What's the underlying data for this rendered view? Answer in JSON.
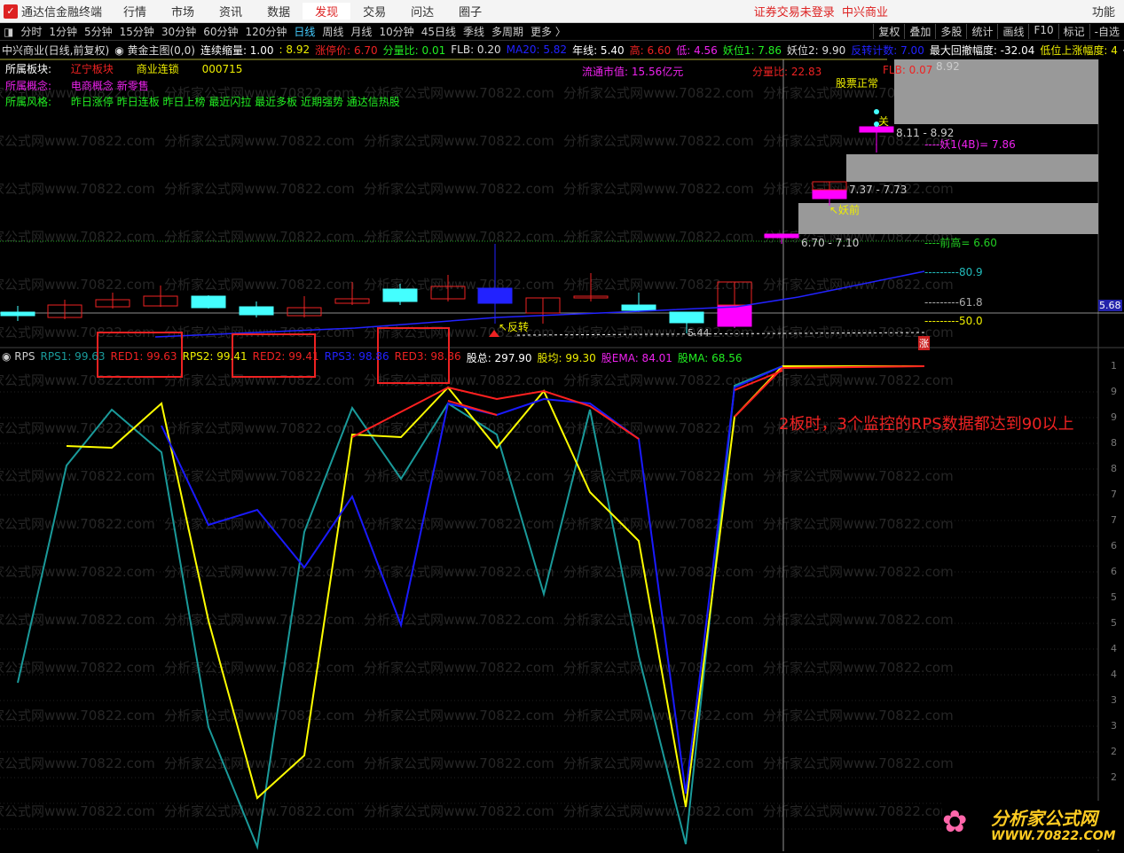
{
  "menu": {
    "app_title": "通达信金融终端",
    "items": [
      "行情",
      "市场",
      "资讯",
      "数据",
      "发现",
      "交易",
      "问达",
      "圈子"
    ],
    "active": "发现",
    "status": "证券交易未登录",
    "stock": "中兴商业",
    "function": "功能"
  },
  "periods": {
    "items": [
      "分时",
      "1分钟",
      "5分钟",
      "15分钟",
      "30分钟",
      "60分钟",
      "120分钟",
      "日线",
      "周线",
      "月线",
      "10分钟",
      "45日线",
      "季线",
      "多周期",
      "更多 〉"
    ],
    "selected": "日线",
    "tools": [
      "复权",
      "叠加",
      "多股",
      "统计",
      "画线",
      "F10",
      "标记",
      "-自选"
    ]
  },
  "info": {
    "name": "中兴商业(日线,前复权)",
    "indicator": "黄金主图(0,0)",
    "shrink": "连续缩量: 1.00",
    "price": ": 8.92",
    "limit": "涨停价: 6.70",
    "ratio": "分量比: 0.01",
    "flb": "FLB: 0.20",
    "ma20": "MA20: 5.82",
    "yearline": "年线: 5.40",
    "high": "高: 6.60",
    "low": "低: 4.56",
    "yao1": "妖位1: 7.86",
    "yao2": "妖位2: 9.90",
    "count": "反转计数: 7.00",
    "maxdd": "最大回撤幅度: -32.04",
    "lowrise": "低位上涨幅度: 4"
  },
  "sectors": {
    "block_label": "所属板块:",
    "block1": "辽宁板块",
    "block2": "商业连锁",
    "code": "000715",
    "concept_label": "所属概念:",
    "concepts": "电商概念 新零售",
    "style_label": "所属风格:",
    "styles": "昨日涨停 昨日连板 昨日上榜 最近闪拉 最近多板 近期强势 通达信热股"
  },
  "overlay": {
    "float_cap": "流通市值: 15.56亿元",
    "fen_ratio": "分量比: 22.83",
    "flb": "FLB: 0.07",
    "top_price": "8.92",
    "stock_status": "股票正常",
    "guan": "关",
    "range1": "8.11 - 8.92",
    "yao1": "----妖1(4B)= 7.86",
    "range2": "7.37 - 7.73",
    "yaoqian": "↖妖前",
    "range3": "6.70 - 7.10",
    "prev_high": "----前高= 6.60",
    "fib809": "---------80.9",
    "fib618": "---------61.8",
    "fib500": "---------50.0",
    "reverse": "↖反转",
    "low_mark": "5.44",
    "zhang": "涨",
    "price_tag": "5.68"
  },
  "rps": {
    "title": "RPS",
    "rps1": "RPS1: 99.63",
    "red1": "RED1: 99.63",
    "rps2": "RPS2: 99.41",
    "red2": "RED2: 99.41",
    "rps3": "RPS3: 98.86",
    "red3": "RED3: 98.86",
    "total": "股总: 297.90",
    "avg": "股均: 99.30",
    "ema": "股EMA: 84.01",
    "ma": "股MA: 68.56"
  },
  "annotation": "2板时，3个监控的RPS数据都达到90以上",
  "axis_ticks": [
    "1",
    "9",
    "9",
    "8",
    "8",
    "7",
    "7",
    "6",
    "6",
    "5",
    "5",
    "4",
    "4",
    "3",
    "3",
    "2",
    "2"
  ],
  "watermark": "分析家公式网www.70822.com",
  "brand": {
    "name": "分析家公式网",
    "url": "WWW.70822.COM"
  },
  "colors": {
    "teal": "#1a9a9a",
    "yellow": "#ffff00",
    "blue": "#1a1aff",
    "red": "#ff2020",
    "magenta": "#ff00ff",
    "cyan": "#4ff"
  }
}
